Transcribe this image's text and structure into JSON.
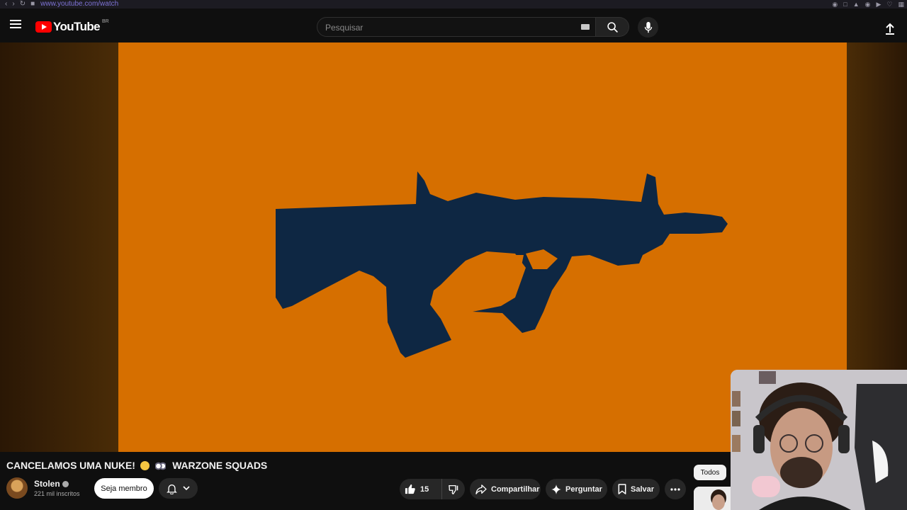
{
  "browser": {
    "url": "www.youtube.com/watch"
  },
  "header": {
    "logo_text": "YouTube",
    "country_code": "BR",
    "search_placeholder": "Pesquisar"
  },
  "video": {
    "title_part1": "CANCELAMOS UMA NUKE!",
    "title_part2": "WARZONE SQUADS",
    "frame_color": "#d66f00",
    "silhouette_color": "#0e2743"
  },
  "channel": {
    "name": "Stolen",
    "subscribers": "221 mil inscritos",
    "join_label": "Seja membro"
  },
  "actions": {
    "like_count": "15",
    "share_label": "Compartilhar",
    "ask_label": "Perguntar",
    "save_label": "Salvar"
  },
  "sidebar": {
    "chip_all": "Todos"
  }
}
